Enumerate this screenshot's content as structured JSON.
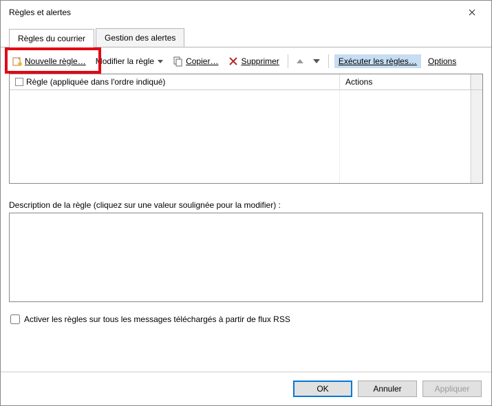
{
  "title": "Règles et alertes",
  "tabs": {
    "mail": "Règles du courrier",
    "alerts": "Gestion des alertes"
  },
  "toolbar": {
    "new_rule": "Nouvelle règle…",
    "modify_rule": "Modifier la règle",
    "copy": "Copier…",
    "delete": "Supprimer",
    "run_rules": "Exécuter les règles…",
    "options": "Options"
  },
  "list": {
    "col_rule": "Règle (appliquée dans l'ordre indiqué)",
    "col_actions": "Actions"
  },
  "description_label": "Description de la règle (cliquez sur une valeur soulignée pour la modifier) :",
  "rss_label": "Activer les règles sur tous les messages téléchargés à partir de flux RSS",
  "buttons": {
    "ok": "OK",
    "cancel": "Annuler",
    "apply": "Appliquer"
  }
}
